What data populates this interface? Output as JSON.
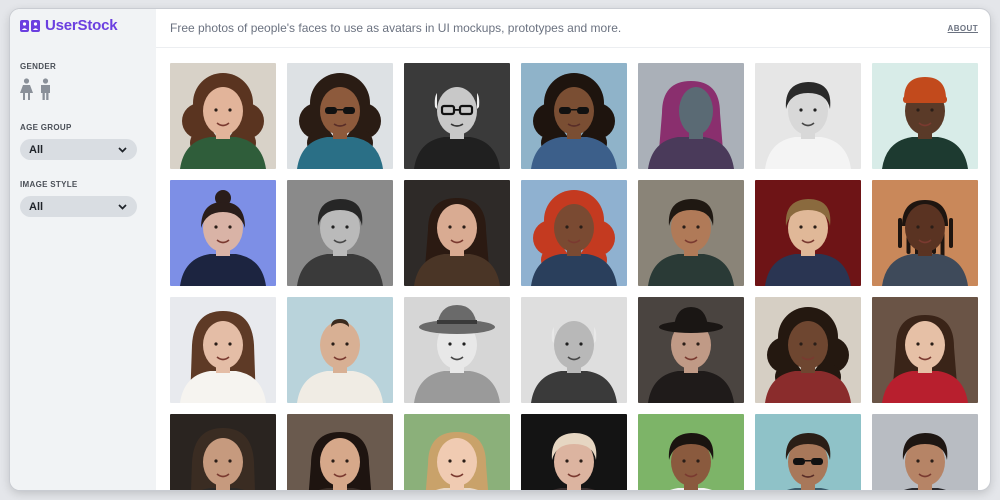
{
  "app": {
    "name": "UserStock",
    "brand_color": "#6b3fe0",
    "tagline": "Free photos of people's faces to use as avatars in UI mockups, prototypes and more.",
    "about_label": "ABOUT"
  },
  "filters": {
    "gender": {
      "label": "GENDER",
      "icons": [
        "female-icon",
        "male-icon"
      ]
    },
    "age_group": {
      "label": "AGE GROUP",
      "value": "All"
    },
    "image_style": {
      "label": "IMAGE STYLE",
      "value": "All"
    }
  },
  "photos": [
    {
      "bg": "#d8d2c8",
      "skin": "#e2b49a",
      "hair": "#5a3420",
      "shirt": "#2f5d3a",
      "hairStyle": "curly"
    },
    {
      "bg": "#dde1e4",
      "skin": "#8d5a3c",
      "hair": "#2a1c14",
      "shirt": "#2a6f86",
      "hairStyle": "curly",
      "glasses": "sun"
    },
    {
      "bg": "#3a3a3a",
      "skin": "#c8c8c8",
      "hair": "#f0f0f0",
      "shirt": "#202020",
      "hairStyle": "bald",
      "glasses": "clear",
      "gray": true
    },
    {
      "bg": "#8fb3c9",
      "skin": "#7a4e33",
      "hair": "#1e140e",
      "shirt": "#3c5f8a",
      "hairStyle": "curly",
      "glasses": "sun"
    },
    {
      "bg": "#aab0b8",
      "skin": "#5a6a74",
      "hair": "#8a2f6e",
      "shirt": "#4a3a5a",
      "hairStyle": "long",
      "profile": true
    },
    {
      "bg": "#e6e6e6",
      "skin": "#d8d8d8",
      "hair": "#2a2a2a",
      "shirt": "#f4f4f4",
      "hairStyle": "short",
      "gray": true
    },
    {
      "bg": "#d8ece8",
      "skin": "#5a3a28",
      "hair": "#c24a1c",
      "shirt": "#1d3a30",
      "hairStyle": "beanie"
    },
    {
      "bg": "#7d8fe6",
      "skin": "#d9b3a6",
      "hair": "#2a1d1a",
      "shirt": "#1c2440",
      "hairStyle": "bun"
    },
    {
      "bg": "#8a8a8a",
      "skin": "#c9b8a8",
      "hair": "#262626",
      "shirt": "#3a3a3a",
      "hairStyle": "short",
      "gray": true
    },
    {
      "bg": "#2e2a28",
      "skin": "#d9ab92",
      "hair": "#2b1a12",
      "shirt": "#4a3526",
      "hairStyle": "long"
    },
    {
      "bg": "#8fb1d0",
      "skin": "#7a4a32",
      "hair": "#c43a20",
      "shirt": "#2a3f5c",
      "hairStyle": "curly"
    },
    {
      "bg": "#8a8478",
      "skin": "#b07a58",
      "hair": "#1f1812",
      "shirt": "#2a3a36",
      "hairStyle": "short"
    },
    {
      "bg": "#6e1416",
      "skin": "#e0b898",
      "hair": "#8a6a3e",
      "shirt": "#2a3552",
      "hairStyle": "short"
    },
    {
      "bg": "#c9885a",
      "skin": "#5a3322",
      "hair": "#1e1510",
      "shirt": "#3e4a5a",
      "hairStyle": "locs"
    },
    {
      "bg": "#e8eaee",
      "skin": "#e4bda6",
      "hair": "#5e3a26",
      "shirt": "#f6f4f0",
      "hairStyle": "hood"
    },
    {
      "bg": "#b9d3db",
      "skin": "#d8b094",
      "hair": "#3a2a1e",
      "shirt": "#f0ece4",
      "hairStyle": "tiny"
    },
    {
      "bg": "#d6d6d6",
      "skin": "#e8e8e8",
      "hair": "#6a6a6a",
      "shirt": "#9a9a9a",
      "hairStyle": "hat",
      "gray": true
    },
    {
      "bg": "#dedede",
      "skin": "#b8b8b8",
      "hair": "#e8e8e8",
      "shirt": "#3a3a3a",
      "hairStyle": "bald",
      "gray": true
    },
    {
      "bg": "#4a4440",
      "skin": "#c09a86",
      "hair": "#1a1614",
      "shirt": "#1f1b1a",
      "hairStyle": "fedora"
    },
    {
      "bg": "#d6cfc4",
      "skin": "#6e4630",
      "hair": "#241810",
      "shirt": "#8a2c2c",
      "hairStyle": "curly"
    },
    {
      "bg": "#6a5446",
      "skin": "#e6c0a6",
      "hair": "#3a2418",
      "shirt": "#b81f2e",
      "hairStyle": "long"
    },
    {
      "bg": "#2a2420",
      "skin": "#c69a7e",
      "hair": "#3a2c22",
      "shirt": "#2c2a28",
      "hairStyle": "hood"
    },
    {
      "bg": "#6a5a4e",
      "skin": "#d6a88a",
      "hair": "#1e1410",
      "shirt": "#3a2e28",
      "hairStyle": "long"
    },
    {
      "bg": "#8bb07a",
      "skin": "#f0cbb2",
      "hair": "#c9a26a",
      "shirt": "#e8d8c8",
      "hairStyle": "long"
    },
    {
      "bg": "#141414",
      "skin": "#dcb4a0",
      "hair": "#e6d6c2",
      "shirt": "#3a3030",
      "hairStyle": "short"
    },
    {
      "bg": "#7db468",
      "skin": "#8a5a3e",
      "hair": "#1a1410",
      "shirt": "#f2f2f2",
      "hairStyle": "short"
    },
    {
      "bg": "#8fc2c8",
      "skin": "#a8785a",
      "hair": "#2a1e16",
      "shirt": "#3a5a6a",
      "hairStyle": "short",
      "glasses": "sun"
    },
    {
      "bg": "#b8bcc2",
      "skin": "#b68466",
      "hair": "#1e1612",
      "shirt": "#2a2a2e",
      "hairStyle": "short"
    }
  ]
}
